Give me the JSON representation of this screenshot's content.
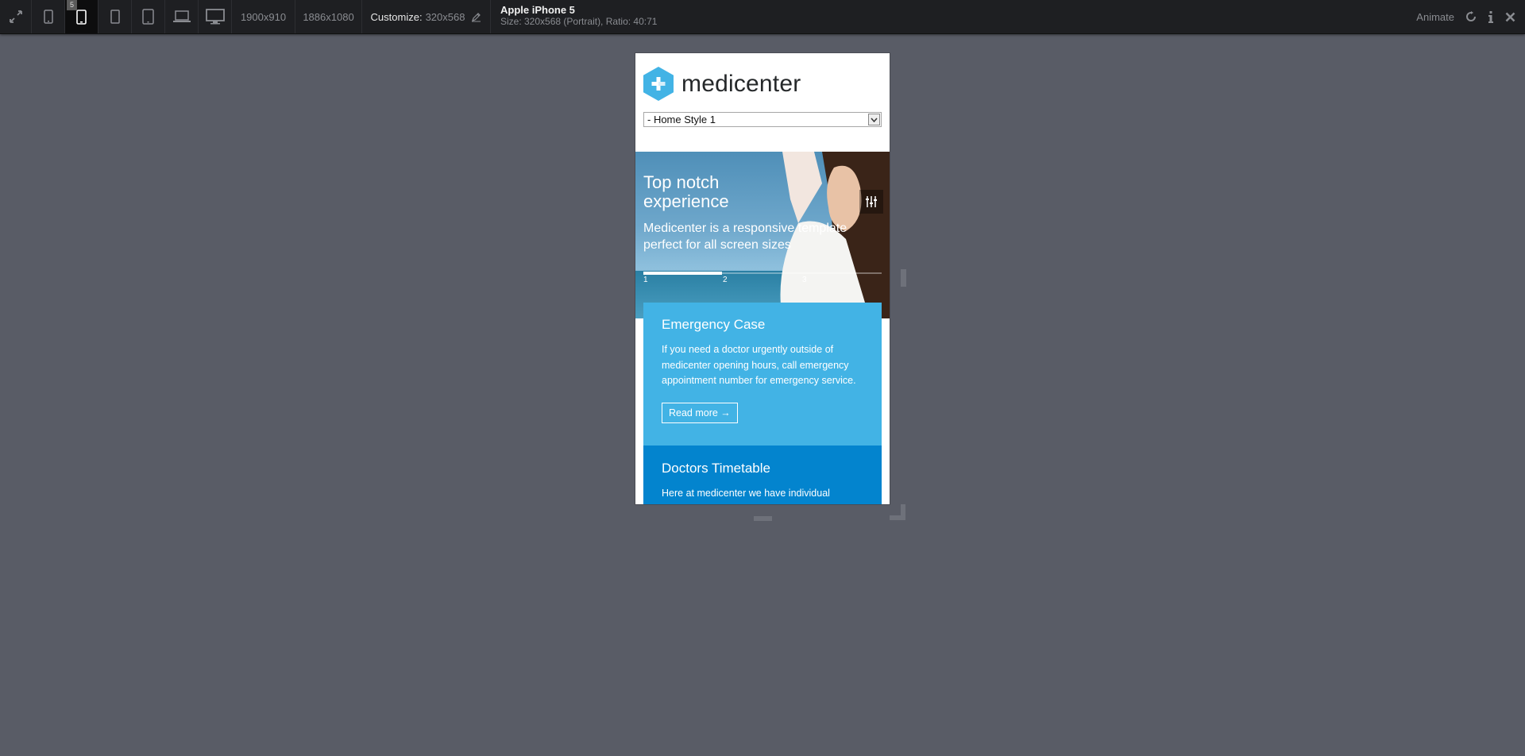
{
  "toolbar": {
    "fullscreen_icon": "expand-arrows-icon",
    "devices": [
      {
        "icon": "phone-small-icon",
        "active": false
      },
      {
        "icon": "phone-icon",
        "active": true,
        "badge": "5"
      },
      {
        "icon": "phone-tall-icon",
        "active": false
      },
      {
        "icon": "tablet-icon",
        "active": false
      },
      {
        "icon": "laptop-icon",
        "active": false
      },
      {
        "icon": "desktop-icon",
        "active": false
      }
    ],
    "res1": "1900x910",
    "res2": "1886x1080",
    "customize_label": "Customize:",
    "customize_value": "320x568",
    "device_name": "Apple iPhone 5",
    "device_size": "Size: 320x568 (Portrait), Ratio: 40:71",
    "animate_label": "Animate",
    "accent": "#42b3e5"
  },
  "site": {
    "logo_text": "medicenter",
    "menu_selected": "- Home Style 1",
    "slide": {
      "title": "Top notch experience",
      "subtitle": "Medicenter is a responsive template perfect for all screen sizes",
      "nav": [
        "1",
        "2",
        "3"
      ],
      "progress": 0.33
    },
    "box1": {
      "title": "Emergency Case",
      "text": "If you need a doctor urgently outside of medicenter opening hours, call emergency appointment number for emergency service.",
      "button": "Read more →",
      "color": "#42b3e5"
    },
    "box2": {
      "title": "Doctors Timetable",
      "text": "Here at medicenter we have individual",
      "color": "#0384ce"
    }
  }
}
